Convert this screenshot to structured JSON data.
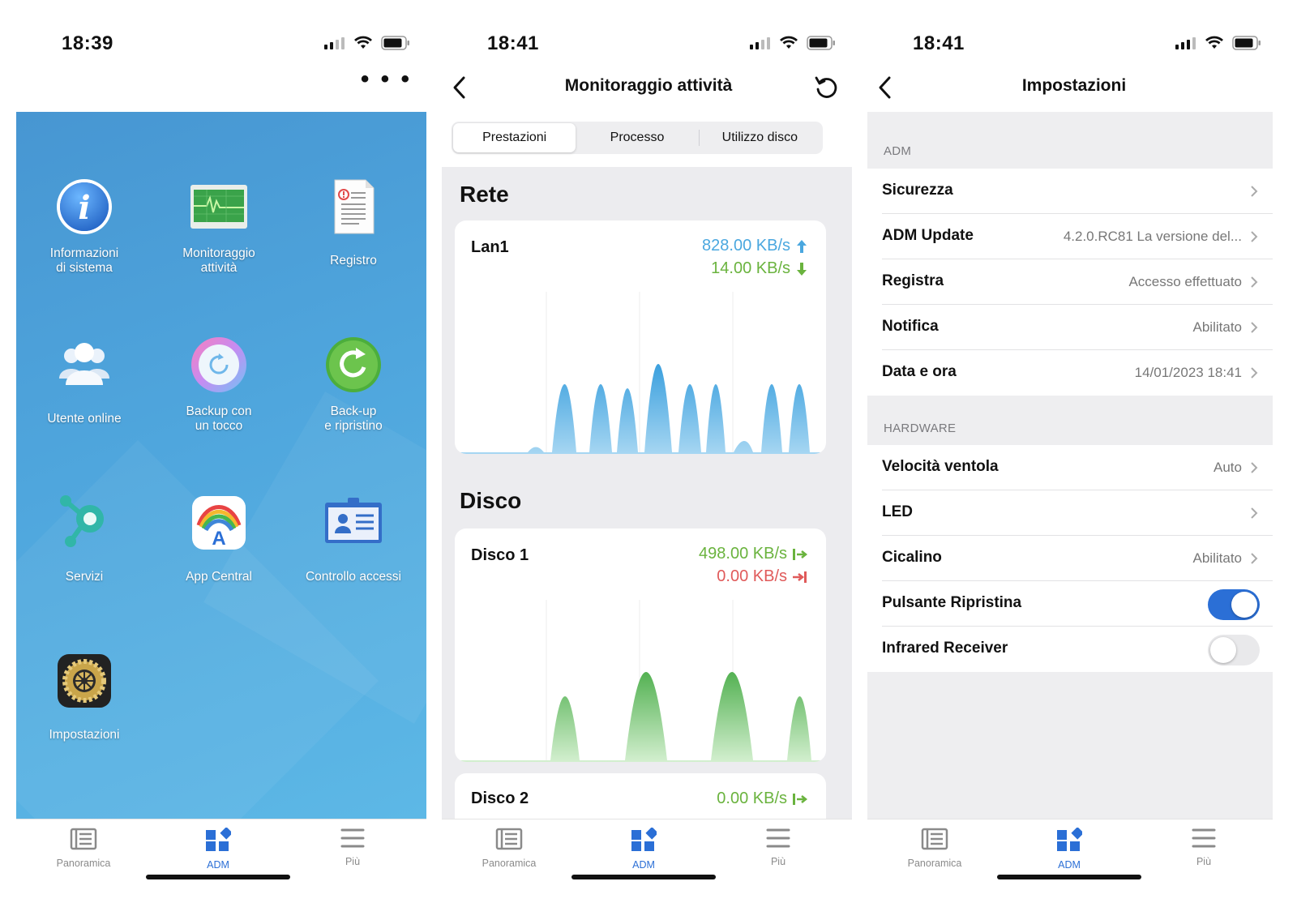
{
  "screen1": {
    "time": "18:39",
    "apps": [
      {
        "label": "Informazioni\ndi sistema",
        "icon": "info-icon"
      },
      {
        "label": "Monitoraggio\nattività",
        "icon": "activity-monitor-icon"
      },
      {
        "label": "Registro",
        "icon": "log-document-icon"
      },
      {
        "label": "Utente online",
        "icon": "online-users-icon"
      },
      {
        "label": "Backup con\nun tocco",
        "icon": "one-touch-backup-icon"
      },
      {
        "label": "Back-up\ne ripristino",
        "icon": "backup-restore-icon"
      },
      {
        "label": "Servizi",
        "icon": "services-icon"
      },
      {
        "label": "App Central",
        "icon": "app-central-icon"
      },
      {
        "label": "Controllo accessi",
        "icon": "access-control-icon"
      },
      {
        "label": "Impostazioni",
        "icon": "settings-gear-icon"
      }
    ]
  },
  "tabbar": {
    "items": [
      {
        "label": "Panoramica",
        "icon": "overview-icon"
      },
      {
        "label": "ADM",
        "icon": "adm-grid-icon"
      },
      {
        "label": "Più",
        "icon": "menu-lines-icon"
      }
    ],
    "active": "ADM",
    "active_color": "#2b6fd6"
  },
  "screen2": {
    "time": "18:41",
    "title": "Monitoraggio attività",
    "segments": [
      "Prestazioni",
      "Processo",
      "Utilizzo disco"
    ],
    "active_segment": "Prestazioni",
    "network": {
      "section_title": "Rete",
      "name": "Lan1",
      "upload": "828.00 KB/s",
      "download": "14.00 KB/s",
      "upload_color": "#4aa7df",
      "download_color": "#6ab33e"
    },
    "disk": {
      "section_title": "Disco",
      "name": "Disco 1",
      "read": "498.00 KB/s",
      "write": "0.00 KB/s",
      "read_color": "#6ab33e",
      "write_color": "#e05a5a"
    },
    "disk2": {
      "name": "Disco 2",
      "read": "0.00 KB/s"
    }
  },
  "screen3": {
    "time": "18:41",
    "title": "Impostazioni",
    "groups": [
      {
        "header": "ADM",
        "rows": [
          {
            "label": "Sicurezza",
            "value": ""
          },
          {
            "label": "ADM Update",
            "value": "4.2.0.RC81 La versione del..."
          },
          {
            "label": "Registra",
            "value": "Accesso effettuato"
          },
          {
            "label": "Notifica",
            "value": "Abilitato"
          },
          {
            "label": "Data e ora",
            "value": "14/01/2023 18:41"
          }
        ]
      },
      {
        "header": "HARDWARE",
        "rows": [
          {
            "label": "Velocità ventola",
            "value": "Auto"
          },
          {
            "label": "LED",
            "value": ""
          },
          {
            "label": "Cicalino",
            "value": "Abilitato"
          },
          {
            "label": "Pulsante Ripristina",
            "toggle": true
          },
          {
            "label": "Infrared Receiver",
            "toggle": false
          }
        ]
      }
    ]
  }
}
